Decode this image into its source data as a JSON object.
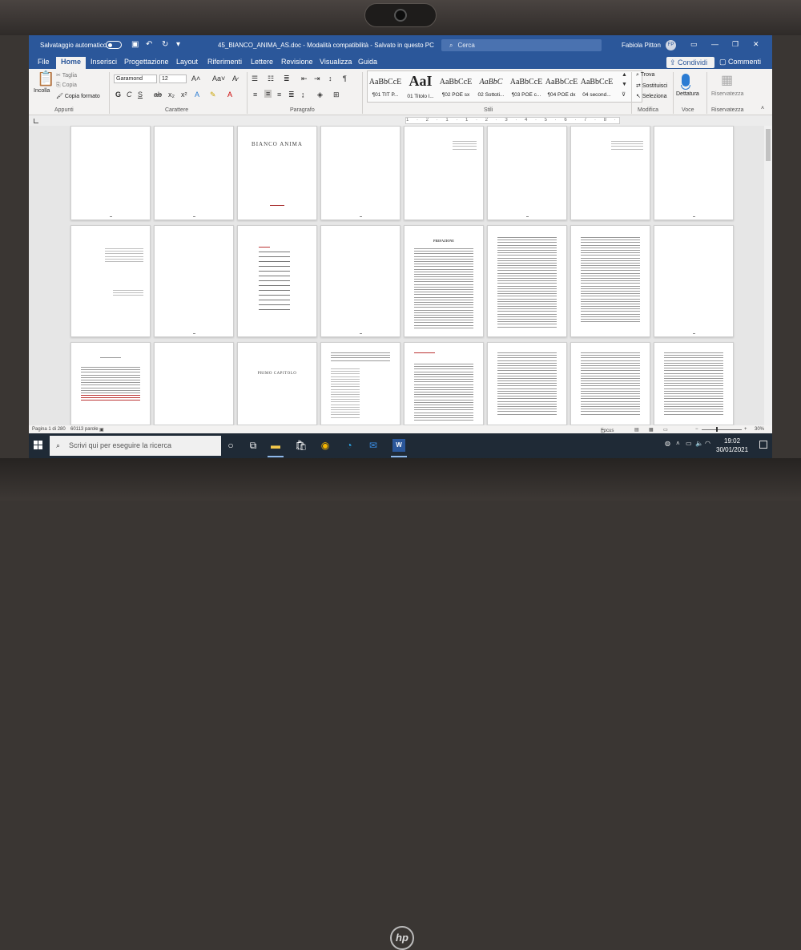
{
  "window": {
    "autosave_label": "Salvataggio automatico",
    "doc_title": "45_BIANCO_ANIMA_AS.doc  -  Modalità compatibilità  -  Salvato in questo PC",
    "search_placeholder": "Cerca",
    "user_name": "Fabiola Pitton",
    "user_initials": "FP"
  },
  "tabs": [
    "File",
    "Home",
    "Inserisci",
    "Progettazione",
    "Layout",
    "Riferimenti",
    "Lettere",
    "Revisione",
    "Visualizza",
    "Guida"
  ],
  "share_label": "Condividi",
  "comments_label": "Commenti",
  "ribbon": {
    "clipboard": {
      "paste": "Incolla",
      "cut": "Taglia",
      "copy": "Copia",
      "format_painter": "Copia formato",
      "label": "Appunti"
    },
    "font": {
      "name": "Garamond",
      "size": "12",
      "label": "Carattere"
    },
    "paragraph": {
      "label": "Paragrafo"
    },
    "styles": {
      "label": "Stili",
      "items": [
        {
          "sample": "AaBbCcE",
          "name": "¶01 TIT P..."
        },
        {
          "sample": "AaI",
          "name": "01 Titolo l..."
        },
        {
          "sample": "AaBbCcE",
          "name": "¶02 POE sx"
        },
        {
          "sample": "AaBbC",
          "name": "02 Sottoti..."
        },
        {
          "sample": "AaBbCcE",
          "name": "¶03 POE c..."
        },
        {
          "sample": "AaBbCcE",
          "name": "¶04 POE dx"
        },
        {
          "sample": "AaBbCcE",
          "name": "04 second..."
        }
      ]
    },
    "editing": {
      "find": "Trova",
      "replace": "Sostituisci",
      "select": "Seleziona",
      "label": "Modifica"
    },
    "voice": {
      "dictate": "Dettatura",
      "label": "Voce"
    },
    "confidentiality": {
      "reuse": "Riservatezza",
      "label": "Riservatezza"
    }
  },
  "ruler_text": "1 · 2 · 1 · 1 · 2 · 3 · 4 · 5 · 6 · 7 · 8 · 9 · 10 · 11 · 12 · 13",
  "pages": {
    "title_page": "BIANCO ANIMA",
    "chapter_page": "PRIMO CAPITOLO",
    "prefazione": "PREFAZIONE"
  },
  "status": {
    "page": "Pagina 1 di 280",
    "words": "60113 parole",
    "focus": "Focus",
    "zoom": "30%"
  },
  "taskbar": {
    "search_placeholder": "Scrivi qui per eseguire la ricerca",
    "time": "19:02",
    "date": "30/01/2021"
  }
}
